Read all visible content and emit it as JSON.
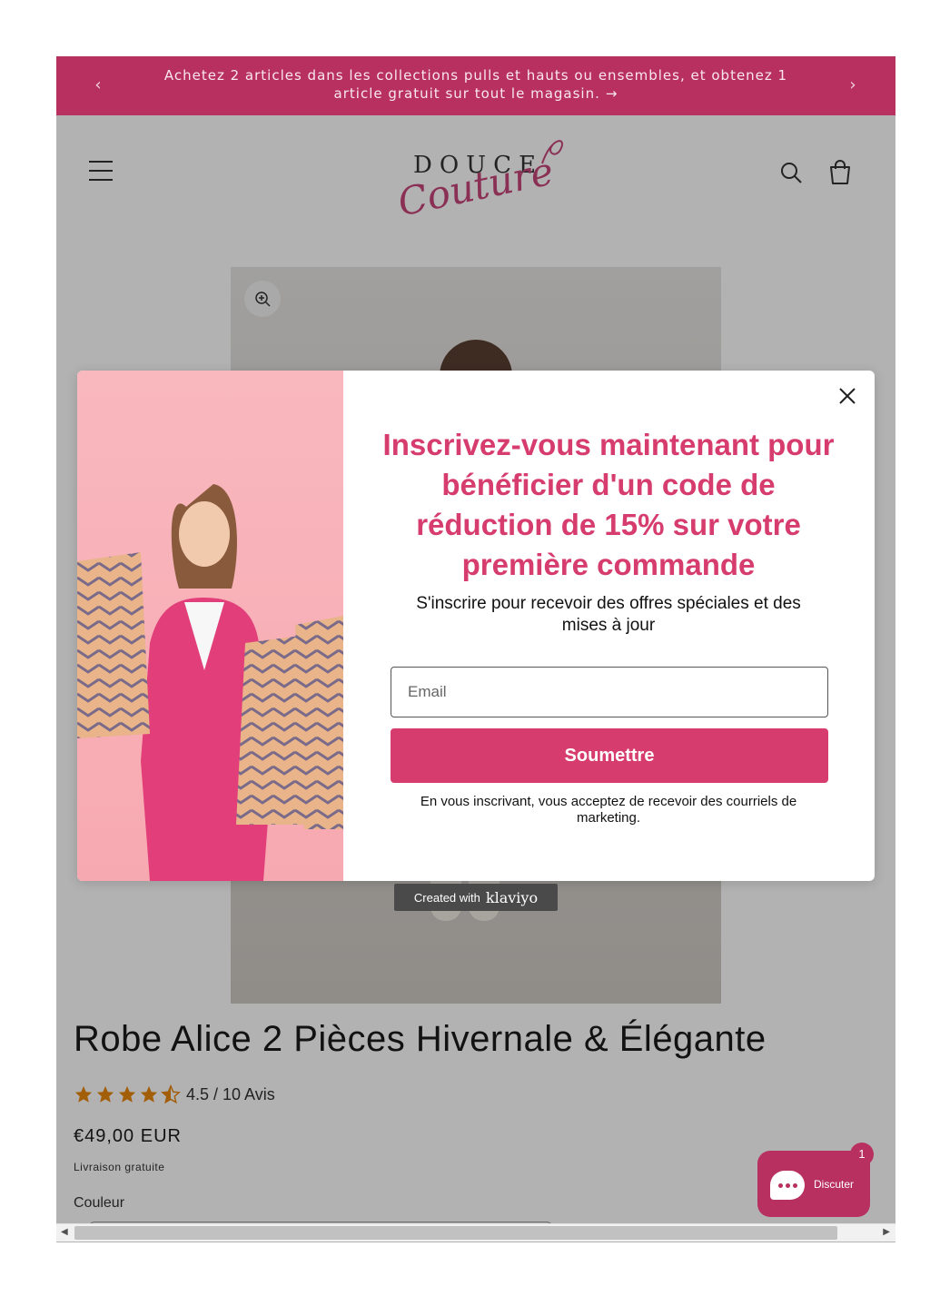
{
  "announcement": {
    "text": "Achetez 2 articles dans les collections pulls et hauts ou ensembles, et obtenez 1 article gratuit sur tout le magasin.",
    "arrow": "→",
    "prev": "‹",
    "next": "›"
  },
  "header": {
    "logo_top": "DOUCE",
    "logo_script": "Couture"
  },
  "product": {
    "title": "Robe Alice 2 Pièces Hivernale & Élégante",
    "rating_text": "4.5 / 10 Avis",
    "rating_value": 4.5,
    "rating_max": 5,
    "price": "€49,00 EUR",
    "shipping": "Livraison gratuite",
    "color_label": "Couleur"
  },
  "popup": {
    "heading": "Inscrivez-vous maintenant pour bénéficier d'un code de réduction de 15% sur votre première commande",
    "subheading": "S'inscrire pour recevoir des offres spéciales et des mises à jour",
    "email_placeholder": "Email",
    "submit_label": "Soumettre",
    "legal": "En vous inscrivant, vous acceptez de recevoir des courriels de marketing."
  },
  "klaviyo": {
    "created_with": "Created with",
    "brand": "klaviyo"
  },
  "chat": {
    "label": "Discuter",
    "count": "1"
  },
  "colors": {
    "brand": "#b8305f",
    "accent": "#d63c6e"
  }
}
